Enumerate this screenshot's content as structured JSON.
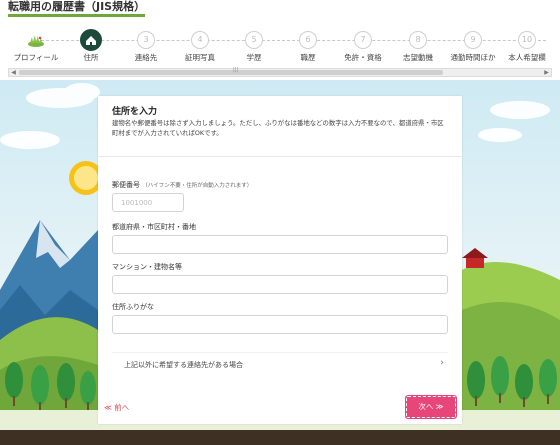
{
  "app": {
    "title": "転職用の履歴書（JIS規格）"
  },
  "steps": [
    {
      "num": "",
      "label": "プロフィール",
      "state": "done",
      "icon": "grass-icon"
    },
    {
      "num": "",
      "label": "住所",
      "state": "current",
      "icon": "house-icon"
    },
    {
      "num": "3",
      "label": "連絡先",
      "state": "todo"
    },
    {
      "num": "4",
      "label": "証明写真",
      "state": "todo"
    },
    {
      "num": "5",
      "label": "学歴",
      "state": "todo"
    },
    {
      "num": "6",
      "label": "職歴",
      "state": "todo"
    },
    {
      "num": "7",
      "label": "免許・資格",
      "state": "todo"
    },
    {
      "num": "8",
      "label": "志望動機",
      "state": "todo"
    },
    {
      "num": "9",
      "label": "通勤時間ほか",
      "state": "todo"
    },
    {
      "num": "10",
      "label": "本人希望欄",
      "state": "todo"
    }
  ],
  "form": {
    "title": "住所を入力",
    "description": "建物名や郵便番号は除さず入力しましょう。ただし、ふりがなは番地などの数字は入力不要なので、都道府県・市区町村までが入力されていればOKです。",
    "postal_label": "郵便番号",
    "postal_hint": "（ハイフン不要・住所が自動入力されます）",
    "postal_placeholder": "1001000",
    "postal_value": "",
    "address_label": "都道府県・市区町村・番地",
    "address_value": "",
    "building_label": "マンション・建物名等",
    "building_value": "",
    "furigana_label": "住所ふりがな",
    "furigana_value": "",
    "other_contact_label": "上記以外に希望する連絡先がある場合",
    "prev_label": "≪ 前へ",
    "next_label": "次へ ≫"
  },
  "colors": {
    "accent_green": "#6fa73a",
    "current_step": "#1e4a3c",
    "next_button": "#e8457a",
    "prev_link": "#e0455f"
  }
}
